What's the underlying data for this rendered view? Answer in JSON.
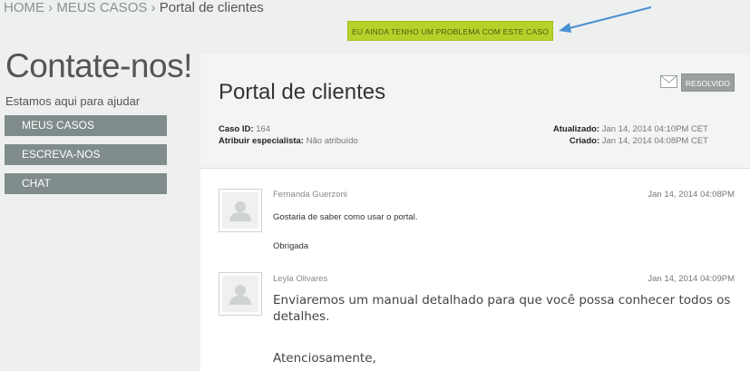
{
  "breadcrumb": {
    "home": "HOME",
    "sep1": "›",
    "my_cases": "MEUS CASOS",
    "sep2": "›",
    "current": "Portal de clientes"
  },
  "problem_button": "EU AINDA TENHO UM PROBLEMA COM ESTE CASO",
  "sidebar": {
    "title": "Contate-nos!",
    "subtitle": "Estamos aqui para ajudar",
    "items": [
      {
        "label": "MEUS CASOS"
      },
      {
        "label": "ESCREVA-NOS"
      },
      {
        "label": "CHAT"
      }
    ]
  },
  "case": {
    "title": "Portal de clientes",
    "status": "RESOLVIDO",
    "id_label": "Caso ID:",
    "id_value": "164",
    "assign_label": "Atribuir especialista:",
    "assign_value": "Não atribuído",
    "updated_label": "Atualizado:",
    "updated_value": "Jan 14, 2014 04:10PM CET",
    "created_label": "Criado:",
    "created_value": "Jan 14, 2014 04:08PM CET"
  },
  "messages": [
    {
      "author": "Fernanda Guerzoni",
      "date": "Jan 14, 2014 04:08PM",
      "line1": "Gostaria de saber como usar o portal.",
      "line2": "Obrigada"
    },
    {
      "author": "Leyla Olivares",
      "date": "Jan 14, 2014 04:09PM",
      "line1": "Enviaremos um manual detalhado para que você possa conhecer todos os detalhes.",
      "line2": "Atenciosamente,"
    }
  ],
  "colors": {
    "accent_green": "#b8d12a",
    "nav_gray": "#7f8c8b",
    "arrow_blue": "#4a8fd0"
  },
  "icons": {
    "arrow": "arrow-icon",
    "mail": "mail-icon",
    "avatar": "user-placeholder-icon"
  }
}
